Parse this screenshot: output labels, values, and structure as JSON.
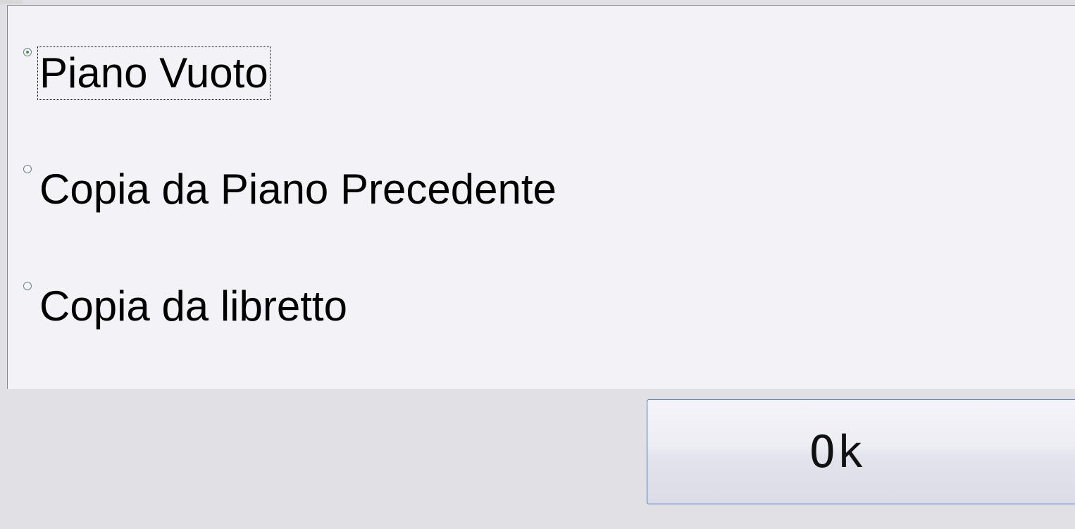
{
  "options": [
    {
      "label": "Piano Vuoto",
      "checked": true
    },
    {
      "label": "Copia da Piano Precedente",
      "checked": false
    },
    {
      "label": "Copia da libretto",
      "checked": false
    }
  ],
  "ok_button": {
    "label": "Ok"
  },
  "colors": {
    "panel_background": "#f3f2f7",
    "footer_background": "#e1e0e5",
    "button_border": "#3d72b8",
    "radio_checked_dot": "#2f9a3d"
  }
}
